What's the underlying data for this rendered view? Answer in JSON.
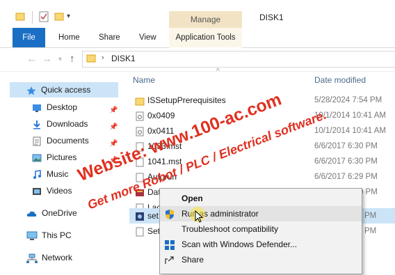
{
  "window": {
    "title": "DISK1",
    "manage_label": "Manage"
  },
  "ribbon": {
    "tabs": [
      "File",
      "Home",
      "Share",
      "View",
      "Application Tools"
    ]
  },
  "address": {
    "path": "DISK1"
  },
  "sidebar": {
    "items": [
      {
        "label": "Quick access",
        "icon": "star-icon"
      },
      {
        "label": "Desktop",
        "icon": "desktop-icon",
        "pinned": true
      },
      {
        "label": "Downloads",
        "icon": "download-arrow-icon",
        "pinned": true
      },
      {
        "label": "Documents",
        "icon": "documents-icon",
        "pinned": true
      },
      {
        "label": "Pictures",
        "icon": "pictures-icon",
        "pinned": true
      },
      {
        "label": "Music",
        "icon": "music-note-icon"
      },
      {
        "label": "Videos",
        "icon": "video-icon"
      },
      {
        "label": "OneDrive",
        "icon": "cloud-icon"
      },
      {
        "label": "This PC",
        "icon": "computer-icon"
      },
      {
        "label": "Network",
        "icon": "network-icon"
      }
    ]
  },
  "files": {
    "header_name": "Name",
    "header_date": "Date modified",
    "rows": [
      {
        "name": "ISSetupPrerequisites",
        "date": "5/28/2024 7:54 PM",
        "icon": "folder-icon"
      },
      {
        "name": "0x0409",
        "date": "10/1/2014 10:41 AM",
        "icon": "settings-file-icon"
      },
      {
        "name": "0x0411",
        "date": "10/1/2014 10:41 AM",
        "icon": "settings-file-icon"
      },
      {
        "name": "1033.mst",
        "date": "6/6/2017 6:30 PM",
        "icon": "document-icon"
      },
      {
        "name": "1041.mst",
        "date": "6/6/2017 6:30 PM",
        "icon": "document-icon"
      },
      {
        "name": "Autorun",
        "date": "6/6/2017 6:29 PM",
        "icon": "document-icon"
      },
      {
        "name": "Data1",
        "date": "6/6/2017 6:30 PM",
        "icon": "archive-icon"
      },
      {
        "name": "Lac",
        "date": "",
        "icon": "document-icon"
      },
      {
        "name": "set",
        "date": "PM",
        "icon": "setup-icon",
        "selected": true
      },
      {
        "name": "Set",
        "date": "PM",
        "icon": "document-icon"
      }
    ]
  },
  "context_menu": {
    "items": [
      {
        "label": "Open",
        "icon": "",
        "bold": true
      },
      {
        "label": "Run as administrator",
        "icon": "shield-icon"
      },
      {
        "label": "Troubleshoot compatibility",
        "icon": ""
      },
      {
        "label": "Scan with Windows Defender...",
        "icon": "defender-icon"
      },
      {
        "label": "Share",
        "icon": "share-icon"
      }
    ]
  },
  "watermark": {
    "line1": "Website: www.100-ac.com",
    "line2": "Get more Robot / PLC / Electrical software."
  },
  "colors": {
    "accent": "#1a6fc4",
    "selection": "#cce4f7",
    "manage_tab": "#f2e3c4",
    "watermark": "#e03020"
  }
}
